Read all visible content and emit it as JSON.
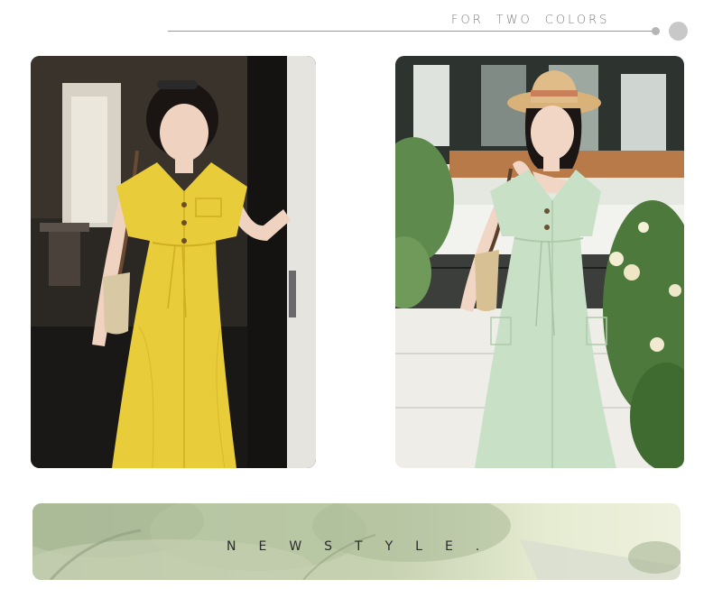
{
  "header": {
    "words": [
      "FOR",
      "TWO",
      "COLORS"
    ]
  },
  "photos": [
    {
      "color_name": "yellow",
      "dress_color": "#e8cc3a",
      "background": "#2a2622"
    },
    {
      "color_name": "mint green",
      "dress_color": "#c8e0c6",
      "background": "#e9ece6"
    }
  ],
  "banner": {
    "text": "NEWSTYLE."
  },
  "colors": {
    "line": "#9a9a9a",
    "text": "#7a7a7a"
  }
}
